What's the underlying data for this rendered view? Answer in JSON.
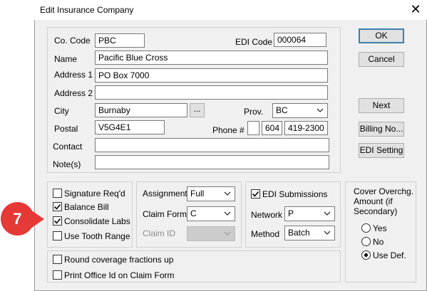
{
  "window": {
    "title": "Edit Insurance Company",
    "close_glyph": "✕"
  },
  "form": {
    "co_code_label": "Co. Code",
    "co_code": "PBC",
    "edi_code_label": "EDI Code",
    "edi_code": "000064",
    "name_label": "Name",
    "name": "Pacific Blue Cross",
    "address1_label": "Address 1",
    "address1": "PO Box 7000",
    "address2_label": "Address 2",
    "address2": "",
    "city_label": "City",
    "city": "Burnaby",
    "city_lookup": "...",
    "prov_label": "Prov.",
    "prov": "BC",
    "postal_label": "Postal",
    "postal": "V5G4E1",
    "phone_label": "Phone #",
    "phone_prefix": "",
    "phone_area": "604",
    "phone_number": "419-2300",
    "contact_label": "Contact",
    "contact": "",
    "notes_label": "Note(s)",
    "notes": ""
  },
  "buttons": {
    "ok": "OK",
    "cancel": "Cancel",
    "next": "Next",
    "billing": "Billing No...",
    "edi_setting": "EDI Setting"
  },
  "options": {
    "signature": {
      "label": "Signature Req'd",
      "checked": false
    },
    "balance_bill": {
      "label": "Balance Bill",
      "checked": true
    },
    "consolidate_labs": {
      "label": "Consolidate Labs",
      "checked": true
    },
    "tooth_range": {
      "label": "Use Tooth Range",
      "checked": false
    }
  },
  "assignment": {
    "assignment_label": "Assignment",
    "assignment": "Full",
    "claim_form_label": "Claim Form",
    "claim_form": "C",
    "claim_id_label": "Claim ID",
    "claim_id": ""
  },
  "edi": {
    "submissions_label": "EDI Submissions",
    "submissions_checked": true,
    "network_label": "Network",
    "network": "P",
    "method_label": "Method",
    "method": "Batch"
  },
  "cover": {
    "title_line1": "Cover Overchg.",
    "title_line2": "Amount (if",
    "title_line3": "Secondary)",
    "options": [
      {
        "label": "Yes",
        "selected": false
      },
      {
        "label": "No",
        "selected": false
      },
      {
        "label": "Use Def.",
        "selected": true
      }
    ]
  },
  "bottom": {
    "round_label": "Round coverage fractions up",
    "round_checked": false,
    "print_label": "Print Office Id on Claim Form",
    "print_checked": false
  },
  "callout": {
    "number": "7",
    "color": "#e53935"
  }
}
